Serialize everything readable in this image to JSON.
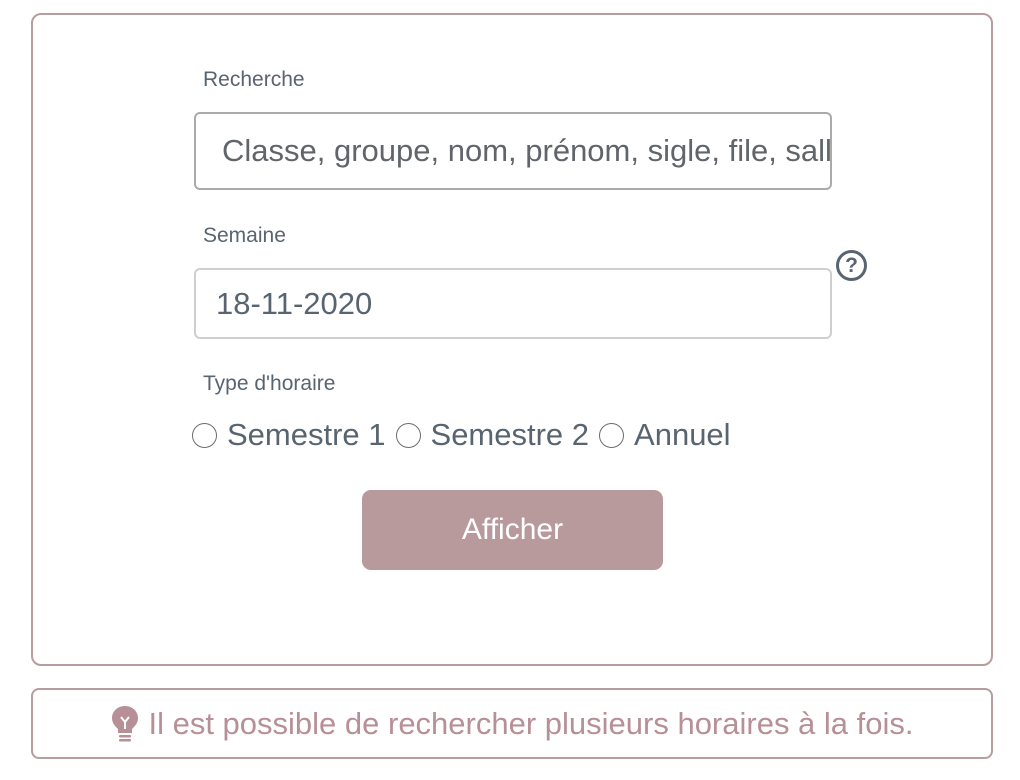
{
  "form": {
    "search": {
      "label": "Recherche",
      "placeholder": "Classe, groupe, nom, prénom, sigle, file, salle",
      "value": ""
    },
    "week": {
      "label": "Semaine",
      "value": "18-11-2020",
      "help_icon": "question-circle-icon"
    },
    "schedule_type": {
      "label": "Type d'horaire",
      "options": [
        {
          "label": "Semestre 1",
          "selected": false
        },
        {
          "label": "Semestre 2",
          "selected": false
        },
        {
          "label": "Annuel",
          "selected": false
        }
      ]
    },
    "submit_label": "Afficher"
  },
  "tip": {
    "icon": "lightbulb-icon",
    "text": "Il est possible de rechercher plusieurs horaires à la fois."
  },
  "colors": {
    "accent": "#b8999c",
    "border": "#b89ca0",
    "tip_text": "#b78f96",
    "text": "#586571"
  }
}
